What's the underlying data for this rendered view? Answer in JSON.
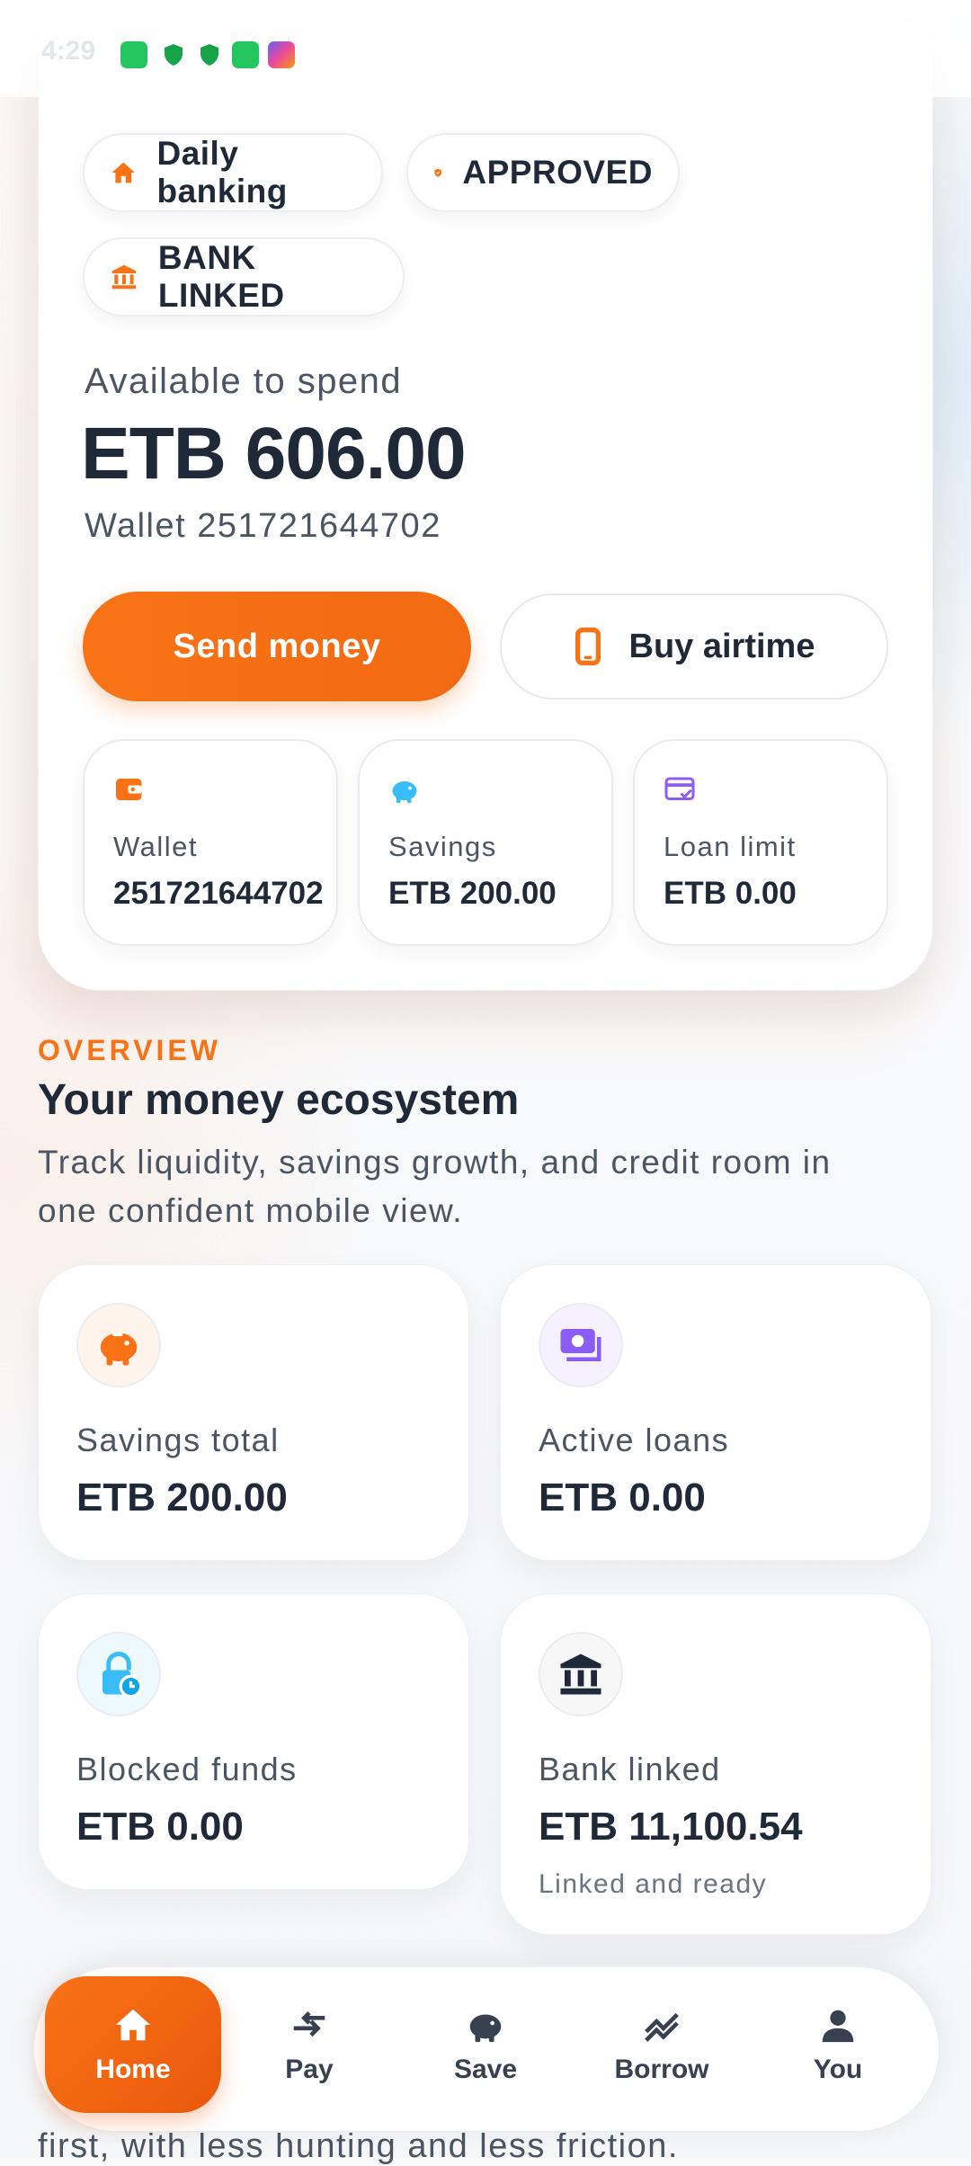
{
  "status_bar": {
    "time": "4:29"
  },
  "hero": {
    "chips": [
      {
        "label": "Daily banking",
        "icon": "home-icon"
      },
      {
        "label": "APPROVED",
        "icon": "shield-check-icon"
      },
      {
        "label": "BANK LINKED",
        "icon": "bank-icon"
      }
    ],
    "available_label": "Available to spend",
    "balance": "ETB 606.00",
    "wallet_line": "Wallet 251721644702",
    "send_button": "Send money",
    "airtime_button": "Buy airtime",
    "mini_cards": [
      {
        "label": "Wallet",
        "value": "251721644702",
        "icon": "wallet-icon"
      },
      {
        "label": "Savings",
        "value": "ETB 200.00",
        "icon": "piggy-bank-icon"
      },
      {
        "label": "Loan limit",
        "value": "ETB 0.00",
        "icon": "credit-card-check-icon"
      }
    ]
  },
  "overview": {
    "kicker": "OVERVIEW",
    "title": "Your money ecosystem",
    "description": "Track liquidity, savings growth, and credit room in one confident mobile view.",
    "stats": [
      {
        "label": "Savings total",
        "value": "ETB 200.00",
        "icon": "piggy-bank-icon"
      },
      {
        "label": "Active loans",
        "value": "ETB 0.00",
        "icon": "cash-stack-icon"
      },
      {
        "label": "Blocked funds",
        "value": "ETB 0.00",
        "icon": "lock-clock-icon"
      },
      {
        "label": "Bank linked",
        "value": "ETB 11,100.54",
        "note": "Linked and ready",
        "icon": "bank-icon"
      }
    ],
    "peek_text": "first, with less hunting and less friction."
  },
  "nav": {
    "items": [
      {
        "label": "Home",
        "icon": "home-icon",
        "active": true
      },
      {
        "label": "Pay",
        "icon": "transfer-arrows-icon"
      },
      {
        "label": "Save",
        "icon": "piggy-bank-icon"
      },
      {
        "label": "Borrow",
        "icon": "trend-chart-icon"
      },
      {
        "label": "You",
        "icon": "person-icon"
      }
    ]
  },
  "colors": {
    "accent": "#f97316",
    "text": "#1f2937",
    "muted": "#4b5563",
    "sky": "#38bdf8",
    "violet": "#8b5cf6"
  }
}
